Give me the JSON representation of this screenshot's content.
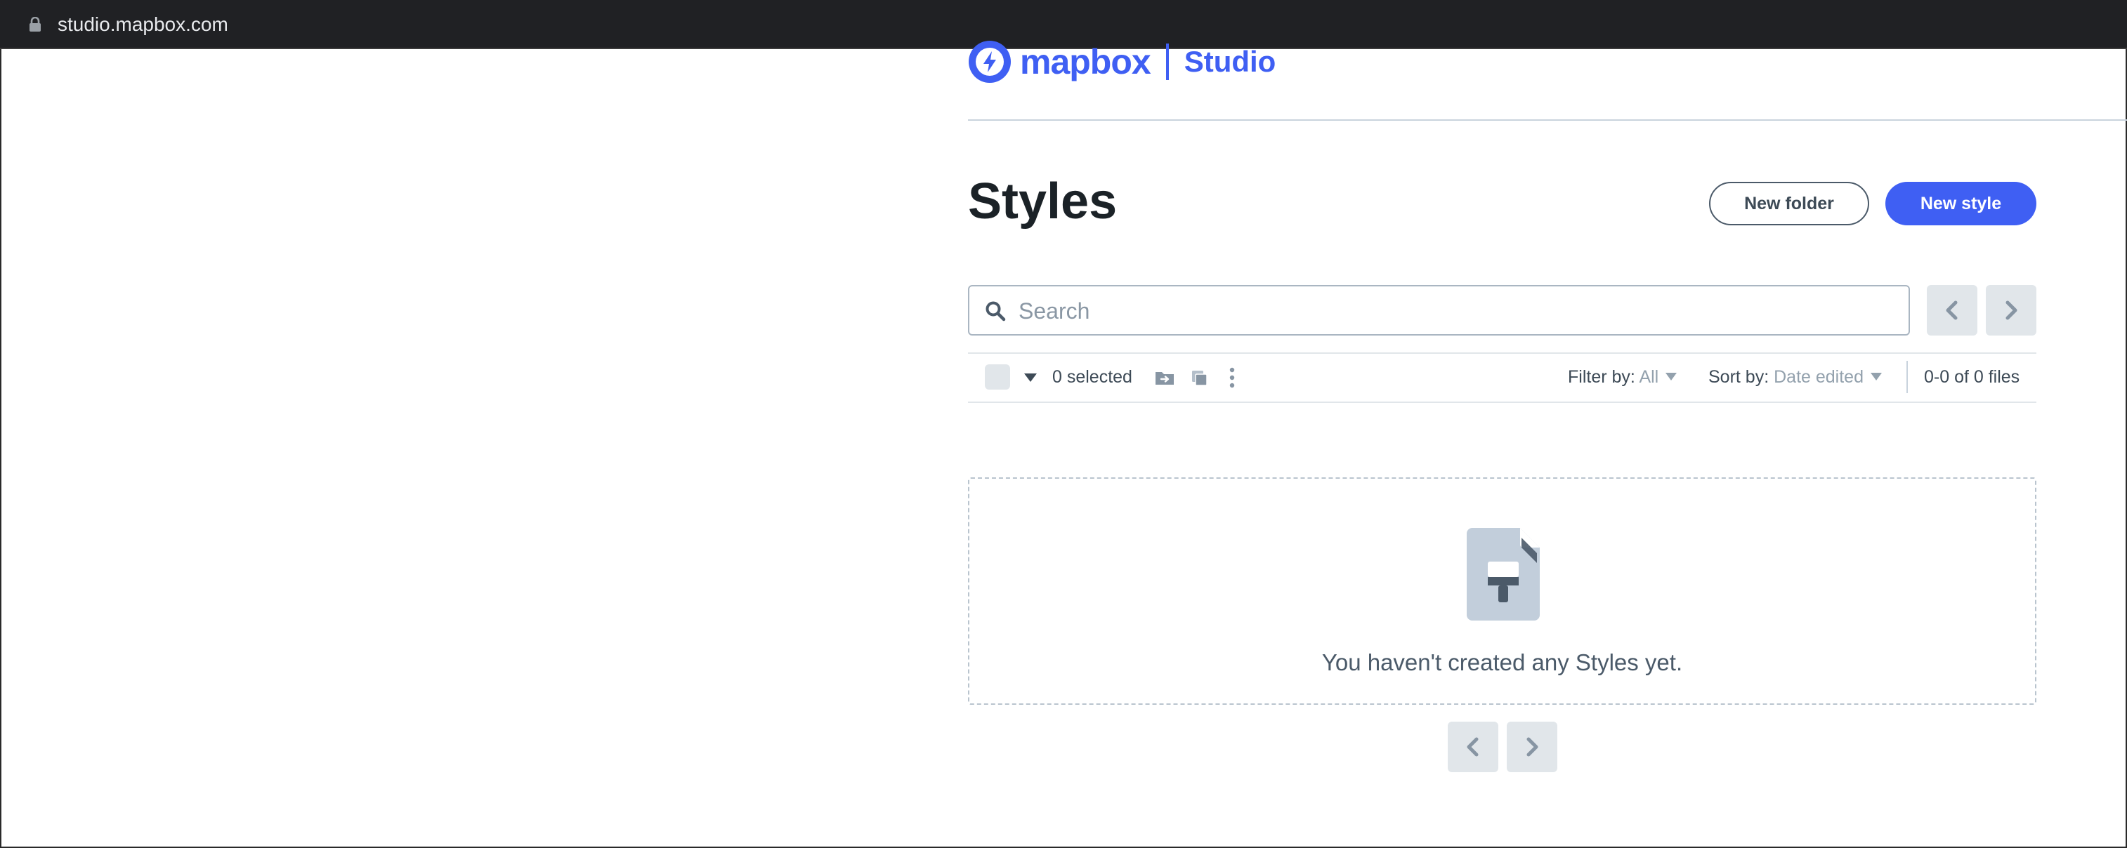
{
  "browser": {
    "url": "studio.mapbox.com"
  },
  "header": {
    "brand": "mapbox",
    "product": "Studio"
  },
  "page": {
    "title": "Styles"
  },
  "actions": {
    "new_folder": "New folder",
    "new_style": "New style"
  },
  "search": {
    "placeholder": "Search",
    "value": ""
  },
  "toolbar": {
    "selected": "0 selected",
    "filter_label": "Filter by:",
    "filter_value": "All",
    "sort_label": "Sort by:",
    "sort_value": "Date edited",
    "count": "0-0 of 0 files"
  },
  "empty_state": {
    "message": "You haven't created any Styles yet."
  },
  "colors": {
    "brand": "#3f5ff3",
    "muted_bg": "#e1e6ea",
    "text": "#1b2227"
  },
  "icons": [
    "lock-icon",
    "mapbox-logo-icon",
    "search-icon",
    "chevron-left-icon",
    "chevron-right-icon",
    "chevron-down-icon",
    "move-to-folder-icon",
    "duplicate-icon",
    "more-vertical-icon",
    "style-file-icon"
  ]
}
